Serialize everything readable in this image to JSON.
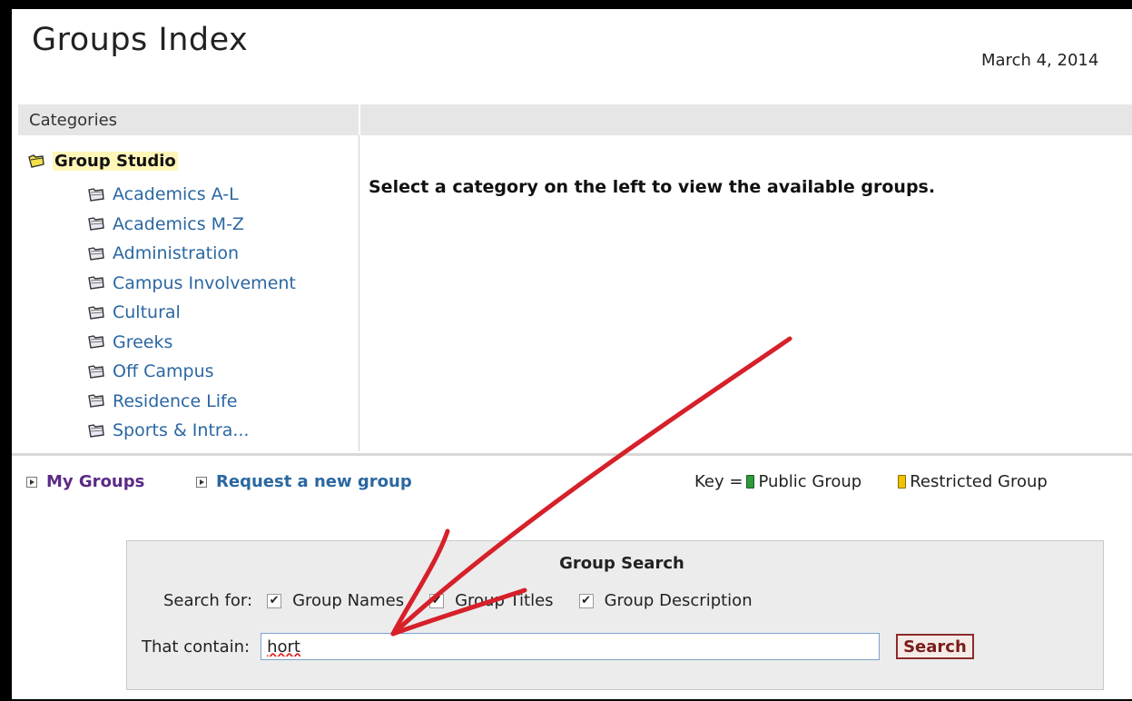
{
  "header": {
    "title": "Groups Index",
    "date": "March 4, 2014"
  },
  "categories": {
    "header_label": "Categories",
    "root": "Group Studio",
    "items": [
      "Academics A-L",
      "Academics M-Z",
      "Administration",
      "Campus Involvement",
      "Cultural",
      "Greeks",
      "Off Campus",
      "Residence Life",
      "Sports & Intra..."
    ]
  },
  "main": {
    "message": "Select a category on the left to view the available groups."
  },
  "links": {
    "my_groups": "My Groups",
    "request_group": "Request a new group"
  },
  "key": {
    "prefix": "Key =",
    "public": "Public Group",
    "restricted": "Restricted Group"
  },
  "search": {
    "title": "Group Search",
    "search_for_label": "Search for:",
    "options": [
      {
        "label": "Group Names",
        "checked": true
      },
      {
        "label": "Group Titles",
        "checked": true
      },
      {
        "label": "Group Description",
        "checked": true
      }
    ],
    "contain_label": "That contain:",
    "input_value": "hort",
    "button_label": "Search"
  },
  "colors": {
    "link_blue": "#2b67a1",
    "my_groups_purple": "#5b2a86",
    "public_key": "#2e9a3b",
    "restricted_key": "#f2c200",
    "folder_root": "#f3e14a",
    "annotation_arrow": "#d6202a"
  }
}
